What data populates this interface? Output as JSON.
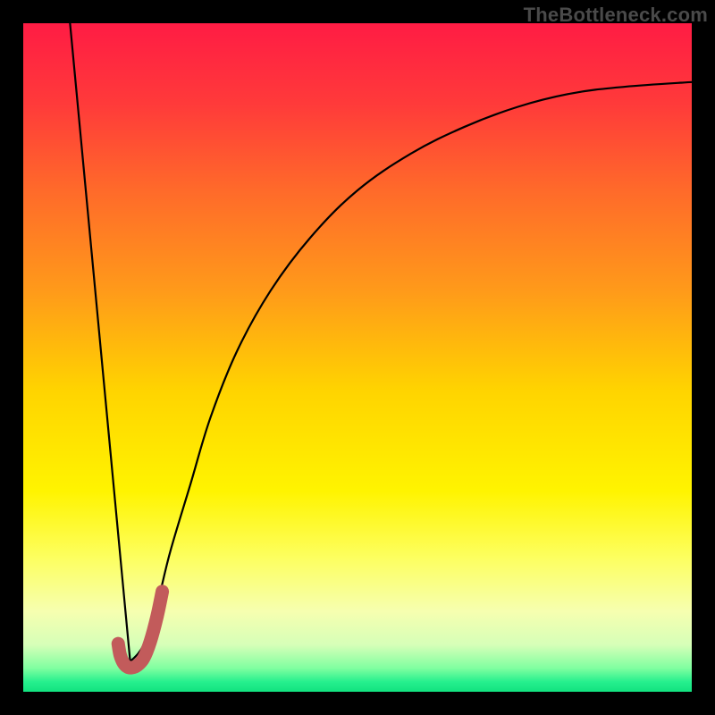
{
  "watermark": "TheBottleneck.com",
  "gradient": {
    "stops": [
      {
        "offset": 0.0,
        "color": "#ff1c44"
      },
      {
        "offset": 0.12,
        "color": "#ff3a3a"
      },
      {
        "offset": 0.25,
        "color": "#ff6a2a"
      },
      {
        "offset": 0.4,
        "color": "#ff9a1a"
      },
      {
        "offset": 0.55,
        "color": "#ffd400"
      },
      {
        "offset": 0.7,
        "color": "#fff400"
      },
      {
        "offset": 0.8,
        "color": "#fdff60"
      },
      {
        "offset": 0.88,
        "color": "#f6ffb0"
      },
      {
        "offset": 0.93,
        "color": "#d6ffb8"
      },
      {
        "offset": 0.965,
        "color": "#7fffa0"
      },
      {
        "offset": 0.985,
        "color": "#26f08e"
      },
      {
        "offset": 1.0,
        "color": "#12e27f"
      }
    ]
  },
  "chart_data": {
    "type": "line",
    "title": "",
    "xlabel": "",
    "ylabel": "",
    "xlim": [
      0,
      100
    ],
    "ylim": [
      0,
      100
    ],
    "series": [
      {
        "name": "left-line",
        "x": [
          7,
          16
        ],
        "y": [
          100,
          4.5
        ]
      },
      {
        "name": "right-curve",
        "x": [
          16,
          18,
          20,
          22,
          25,
          28,
          32,
          37,
          43,
          50,
          58,
          66,
          74,
          82,
          90,
          100
        ],
        "y": [
          4.5,
          7,
          13,
          21,
          31,
          41,
          51,
          60,
          68,
          75,
          80.5,
          84.5,
          87.5,
          89.5,
          90.5,
          91.2
        ]
      },
      {
        "name": "highlight-hook",
        "x": [
          14.2,
          14.5,
          15,
          15.6,
          16.2,
          17,
          18,
          19,
          20,
          20.8
        ],
        "y": [
          7.2,
          5.5,
          4.3,
          3.7,
          3.6,
          3.9,
          5,
          7.5,
          11.2,
          15
        ]
      }
    ]
  }
}
